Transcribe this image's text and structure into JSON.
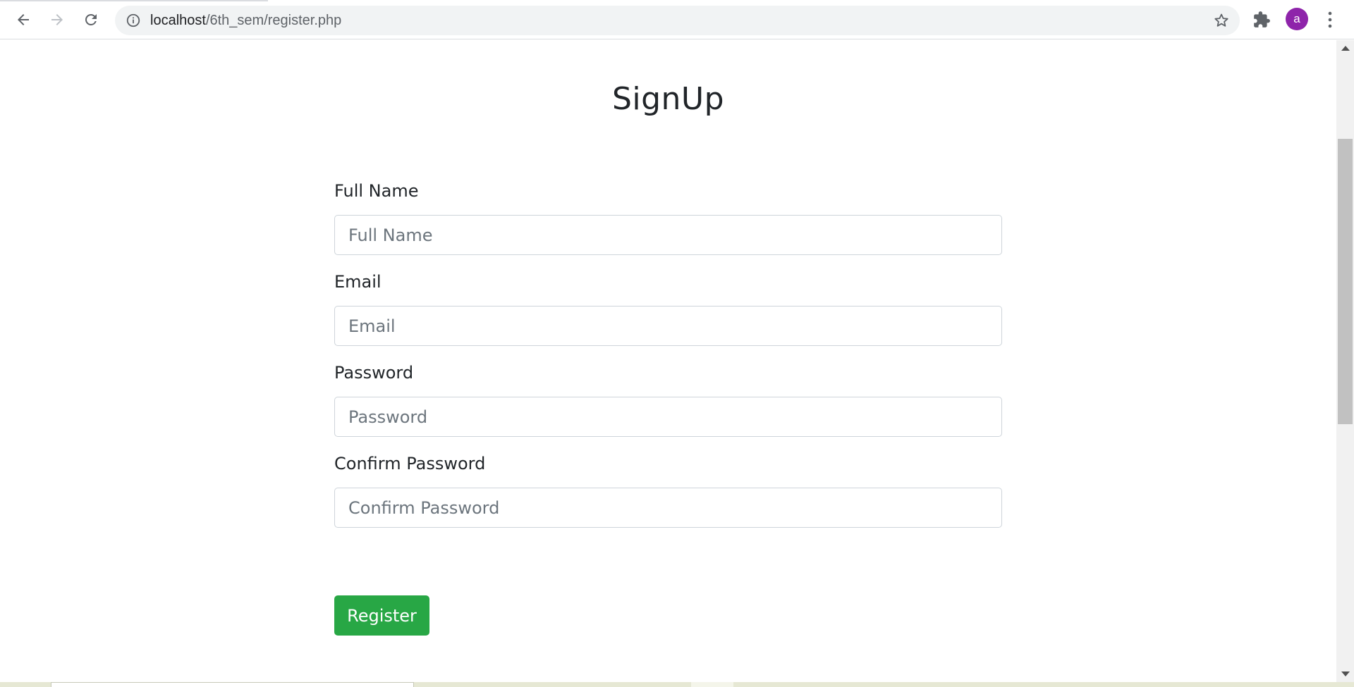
{
  "browser": {
    "url_host": "localhost",
    "url_path": "/6th_sem/register.php",
    "profile_initial": "a",
    "colors": {
      "omnibox_bg": "#f1f3f4",
      "avatar_bg": "#8e24aa"
    }
  },
  "page": {
    "title": "SignUp",
    "fields": [
      {
        "label": "Full Name",
        "placeholder": "Full Name",
        "value": ""
      },
      {
        "label": "Email",
        "placeholder": "Email",
        "value": ""
      },
      {
        "label": "Password",
        "placeholder": "Password",
        "value": ""
      },
      {
        "label": "Confirm Password",
        "placeholder": "Confirm Password",
        "value": ""
      }
    ],
    "submit_label": "Register",
    "colors": {
      "submit_bg": "#28a745",
      "input_border": "#ced4da"
    }
  },
  "icons": [
    "back-arrow-icon",
    "forward-arrow-icon",
    "reload-icon",
    "info-icon",
    "star-icon",
    "puzzle-extension-icon",
    "kebab-menu-icon"
  ]
}
